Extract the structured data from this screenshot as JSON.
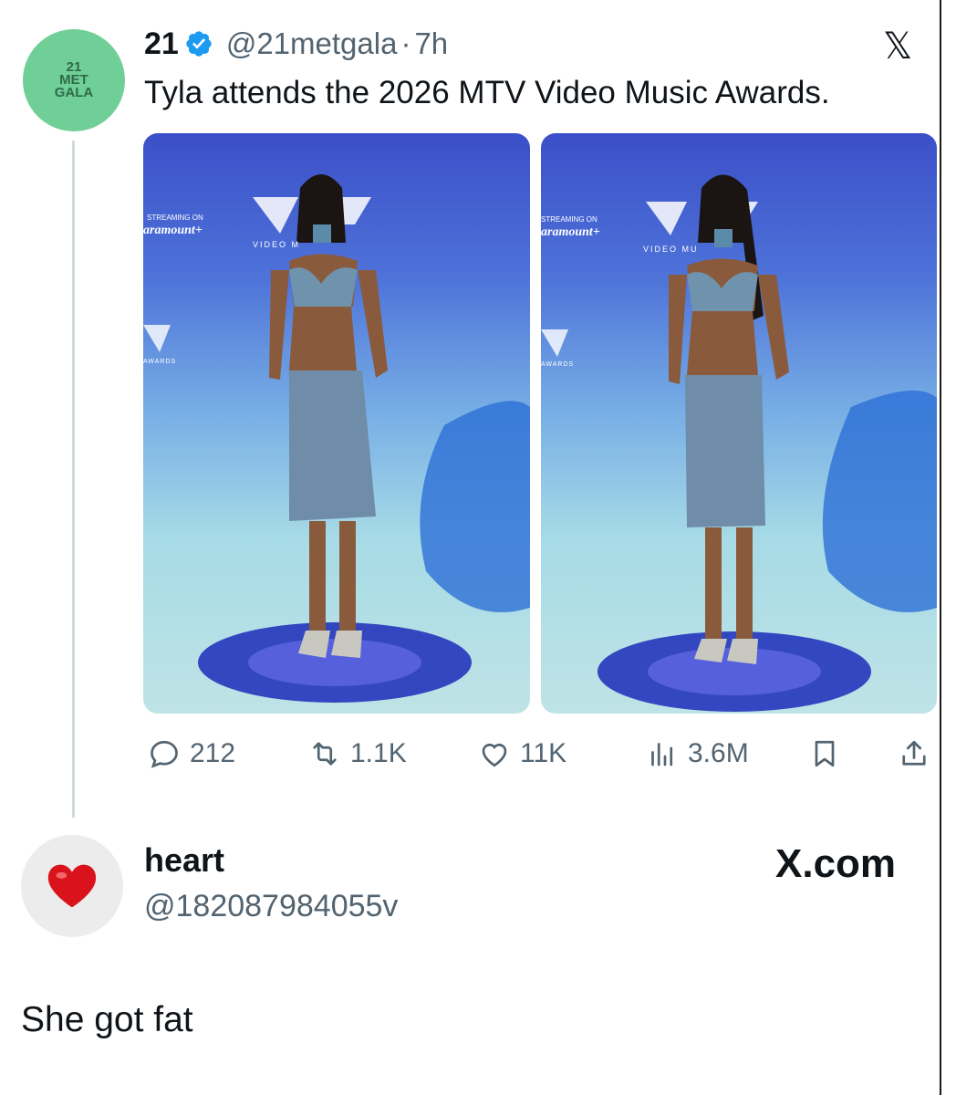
{
  "tweet": {
    "avatar_text": [
      "21",
      "MET",
      "GALA"
    ],
    "name": "21",
    "handle": "@21metgala",
    "separator": "·",
    "time": "7h",
    "text": "Tyla attends the 2026 MTV Video Music Awards.",
    "platform_icon": "x-logo-icon",
    "photos": [
      {
        "streaming_label": "STREAMING ON",
        "brand": "aramount+",
        "video_label": "VIDEO M",
        "awards_label": "AWARDS"
      },
      {
        "streaming_label": "STREAMING ON",
        "brand": "aramount+",
        "video_label": "VIDEO MU",
        "awards_label": "AWARDS"
      }
    ],
    "actions": {
      "replies": "212",
      "retweets": "1.1K",
      "likes": "11K",
      "views": "3.6M"
    }
  },
  "reply": {
    "avatar_icon": "red-heart-icon",
    "name": "heart",
    "handle": "@182087984055v",
    "watermark": "X.com",
    "text": "She got fat"
  },
  "colors": {
    "avatar_green": "#6fcf97",
    "verified_blue": "#1d9bf0",
    "secondary_text": "#536471",
    "heart_red": "#d9121b"
  }
}
